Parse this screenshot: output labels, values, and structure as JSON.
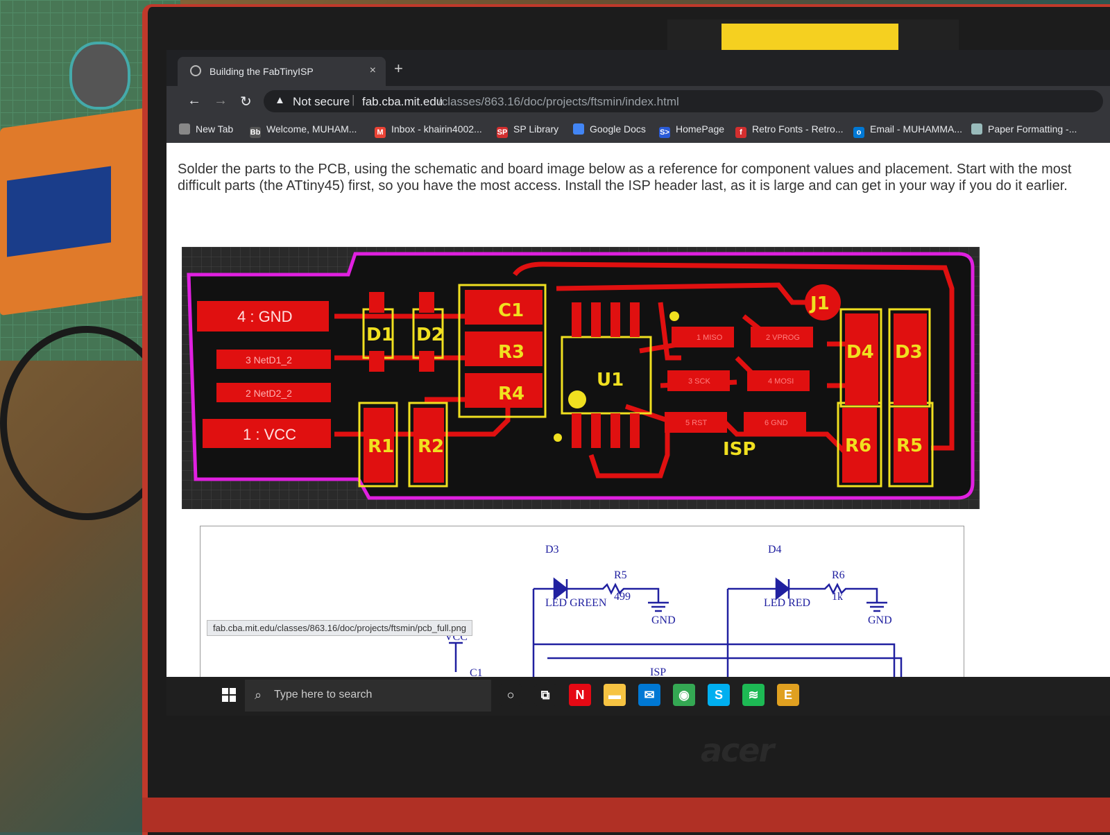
{
  "browser": {
    "tab_title": "Building the FabTinyISP",
    "tab_close": "×",
    "new_tab": "+",
    "security_label": "Not secure",
    "url_host": "fab.cba.mit.edu",
    "url_path": "/classes/863.16/doc/projects/ftsmin/index.html",
    "bookmarks": [
      {
        "label": "New Tab",
        "icon": "globe-icon",
        "color": "#888888"
      },
      {
        "label": "Welcome, MUHAM...",
        "icon": "Bb",
        "color": "#555555"
      },
      {
        "label": "Inbox - khairin4002...",
        "icon": "M",
        "color": "#ea4335"
      },
      {
        "label": "SP Library",
        "icon": "SP",
        "color": "#d32f2f"
      },
      {
        "label": "Google Docs",
        "icon": "docs-icon",
        "color": "#4285f4"
      },
      {
        "label": "HomePage",
        "icon": "S>",
        "color": "#2a5bd7"
      },
      {
        "label": "Retro Fonts - Retro...",
        "icon": "f",
        "color": "#d32f2f"
      },
      {
        "label": "Email - MUHAMMA...",
        "icon": "o",
        "color": "#0078d4"
      },
      {
        "label": "Paper Formatting -...",
        "icon": "cloud-icon",
        "color": "#9bb"
      }
    ]
  },
  "page": {
    "paragraph": "Solder the parts to the PCB, using the schematic and board image below as a reference for component values and placement. Start with the most difficult parts (the ATtiny45) first, so you have the most access. Install the ISP header last, as it is large and can get in your way if you do it earlier.",
    "pcb": {
      "pads_left": [
        "4 : GND",
        "3 NetD1_2",
        "2 NetD2_2",
        "1 : VCC"
      ],
      "labels": [
        "D1",
        "D2",
        "C1",
        "R3",
        "R4",
        "R1",
        "R2",
        "U1",
        "J1",
        "D4",
        "D3",
        "R6",
        "R5",
        "ISP"
      ],
      "isp_pins": [
        "1 MISO",
        "2 VPROG",
        "3 SCK",
        "4 MOSI",
        "5 RST",
        "6 GND"
      ]
    },
    "schematic": {
      "d3": "D3",
      "d3_type": "LED GREEN",
      "r5": "R5",
      "r5_val": "499",
      "d4": "D4",
      "d4_type": "LED RED",
      "r6": "R6",
      "r6_val": "1k",
      "gnd": "GND",
      "vcc": "VCC",
      "c1": "C1",
      "isp": "ISP"
    },
    "status_url": "fab.cba.mit.edu/classes/863.16/doc/projects/ftsmin/pcb_full.png"
  },
  "taskbar": {
    "search_placeholder": "Type here to search",
    "apps": [
      {
        "name": "cortana-icon",
        "glyph": "○",
        "color": "#1f1f1f"
      },
      {
        "name": "task-view-icon",
        "glyph": "⧉",
        "color": "#1f1f1f"
      },
      {
        "name": "netflix-icon",
        "glyph": "N",
        "color": "#e50914"
      },
      {
        "name": "file-explorer-icon",
        "glyph": "▬",
        "color": "#f6c342"
      },
      {
        "name": "mail-icon",
        "glyph": "✉",
        "color": "#0078d4"
      },
      {
        "name": "chrome-icon",
        "glyph": "◉",
        "color": "#34a853"
      },
      {
        "name": "skype-icon",
        "glyph": "S",
        "color": "#00aff0"
      },
      {
        "name": "spotify-icon",
        "glyph": "≋",
        "color": "#1db954"
      },
      {
        "name": "e-app-icon",
        "glyph": "E",
        "color": "#e0a020"
      }
    ]
  },
  "device": {
    "brand": "acer"
  }
}
